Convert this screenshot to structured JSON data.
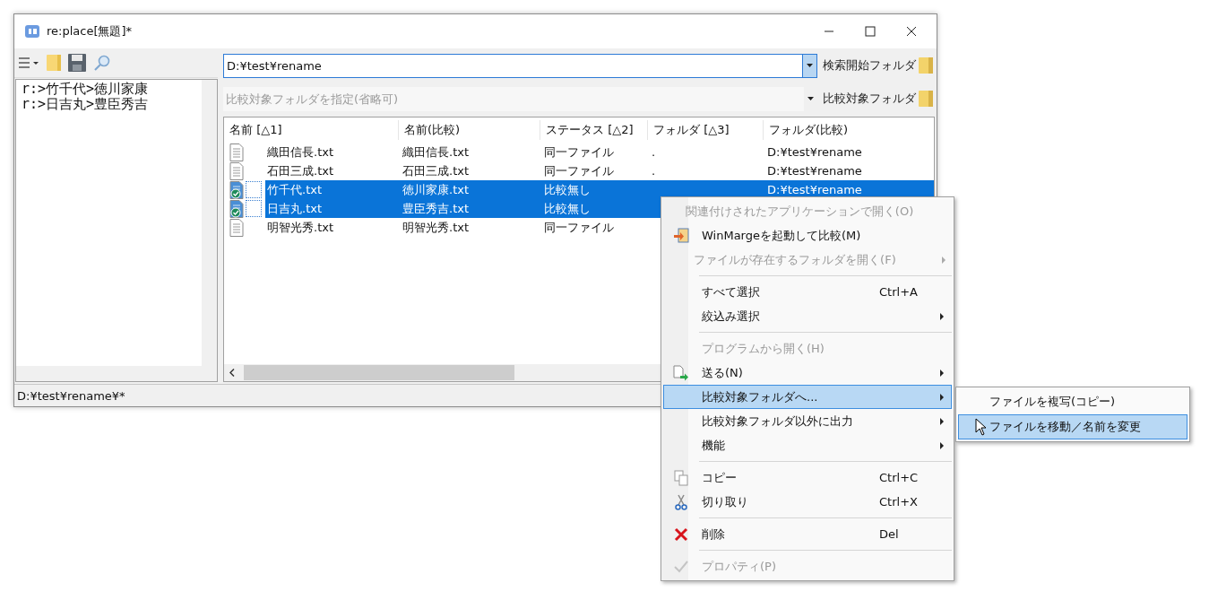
{
  "window": {
    "title": "re:place[無題]*"
  },
  "tree": {
    "lines": [
      "r:>竹千代>徳川家康",
      "r:>日吉丸>豊臣秀吉"
    ]
  },
  "search_folder": {
    "value": "D:¥test¥rename",
    "button": "検索開始フォルダ"
  },
  "compare_folder": {
    "placeholder": "比較対象フォルダを指定(省略可)",
    "button": "比較対象フォルダ"
  },
  "table": {
    "columns": [
      "名前 [△1]",
      "名前(比較)",
      "ステータス [△2]",
      "フォルダ [△3]",
      "フォルダ(比較)"
    ],
    "rows": [
      {
        "name": "織田信長.txt",
        "compare_name": "織田信長.txt",
        "status": "同一ファイル",
        "folder": ".",
        "compare_folder": "D:¥test¥rename",
        "selected": false
      },
      {
        "name": "石田三成.txt",
        "compare_name": "石田三成.txt",
        "status": "同一ファイル",
        "folder": ".",
        "compare_folder": "D:¥test¥rename",
        "selected": false
      },
      {
        "name": "竹千代.txt",
        "compare_name": "徳川家康.txt",
        "status": "比較無し",
        "compare_folder": "D:¥test¥rename",
        "selected": true
      },
      {
        "name": "日吉丸.txt",
        "compare_name": "豊臣秀吉.txt",
        "status": "比較無し",
        "selected": true
      },
      {
        "name": "明智光秀.txt",
        "compare_name": "明智光秀.txt",
        "status": "同一ファイル",
        "selected": false
      }
    ]
  },
  "status_bar": "D:¥test¥rename¥*",
  "context_menu": {
    "items": [
      {
        "kind": "item",
        "label": "関連付けされたアプリケーションで開く(O)",
        "disabled": true,
        "submenu": false,
        "selected": false
      },
      {
        "kind": "item",
        "label": "WinMargeを起動して比較(M)",
        "disabled": false,
        "submenu": false,
        "selected": false
      },
      {
        "kind": "item",
        "label": "ファイルが存在するフォルダを開く(F)",
        "disabled": true,
        "submenu": true,
        "selected": false
      },
      {
        "kind": "separator"
      },
      {
        "kind": "item",
        "label": "すべて選択",
        "shortcut": "Ctrl+A",
        "disabled": false,
        "submenu": false,
        "selected": false
      },
      {
        "kind": "item",
        "label": "絞込み選択",
        "disabled": false,
        "submenu": true,
        "selected": false
      },
      {
        "kind": "separator"
      },
      {
        "kind": "item",
        "label": "プログラムから開く(H)",
        "disabled": true,
        "submenu": false,
        "selected": false
      },
      {
        "kind": "item",
        "label": "送る(N)",
        "disabled": false,
        "submenu": true,
        "selected": false
      },
      {
        "kind": "item",
        "label": "比較対象フォルダへ...",
        "disabled": false,
        "submenu": true,
        "selected": true
      },
      {
        "kind": "item",
        "label": "比較対象フォルダ以外に出力",
        "disabled": false,
        "submenu": true,
        "selected": false
      },
      {
        "kind": "item",
        "label": "機能",
        "disabled": false,
        "submenu": true,
        "selected": false
      },
      {
        "kind": "separator"
      },
      {
        "kind": "item",
        "label": "コピー",
        "shortcut": "Ctrl+C",
        "disabled": false,
        "submenu": false,
        "selected": false
      },
      {
        "kind": "item",
        "label": "切り取り",
        "shortcut": "Ctrl+X",
        "disabled": false,
        "submenu": false,
        "selected": false
      },
      {
        "kind": "separator"
      },
      {
        "kind": "item",
        "label": "削除",
        "shortcut": "Del",
        "disabled": false,
        "submenu": false,
        "selected": false
      },
      {
        "kind": "separator"
      },
      {
        "kind": "item",
        "label": "プロパティ(P)",
        "disabled": true,
        "submenu": false,
        "selected": false
      }
    ]
  },
  "submenu": {
    "items": [
      {
        "label": "ファイルを複写(コピー)",
        "selected": false
      },
      {
        "label": "ファイルを移動／名前を変更",
        "selected": true
      }
    ]
  }
}
